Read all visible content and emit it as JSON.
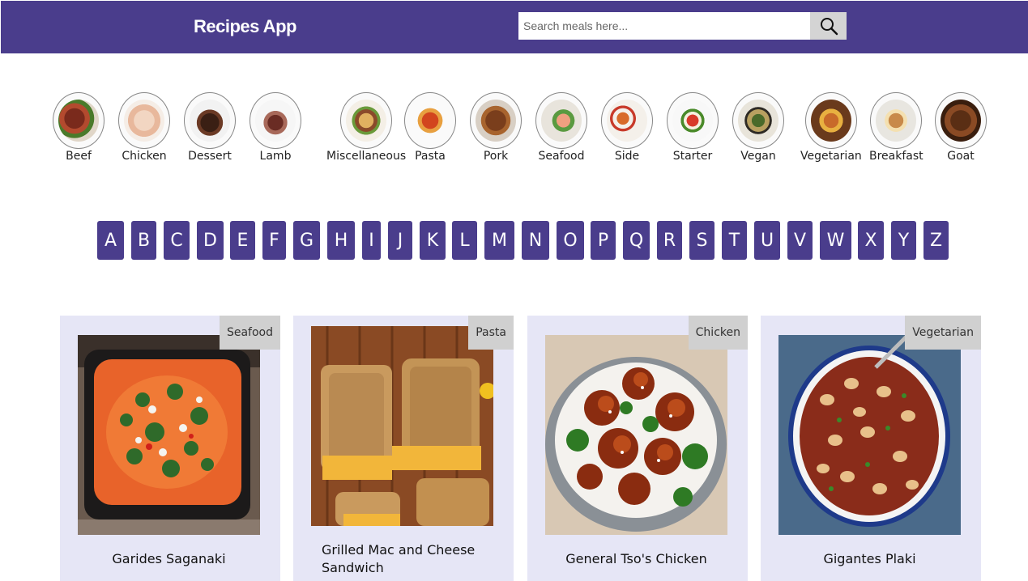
{
  "header": {
    "title": "Recipes App",
    "search_placeholder": "Search meals here...",
    "search_icon": "search-icon"
  },
  "categories": [
    {
      "label": "Beef"
    },
    {
      "label": "Chicken"
    },
    {
      "label": "Dessert"
    },
    {
      "label": "Lamb"
    },
    {
      "label": "Miscellaneous"
    },
    {
      "label": "Pasta"
    },
    {
      "label": "Pork"
    },
    {
      "label": "Seafood"
    },
    {
      "label": "Side"
    },
    {
      "label": "Starter"
    },
    {
      "label": "Vegan"
    },
    {
      "label": "Vegetarian"
    },
    {
      "label": "Breakfast"
    },
    {
      "label": "Goat"
    }
  ],
  "letters": [
    "A",
    "B",
    "C",
    "D",
    "E",
    "F",
    "G",
    "H",
    "I",
    "J",
    "K",
    "L",
    "M",
    "N",
    "O",
    "P",
    "Q",
    "R",
    "S",
    "T",
    "U",
    "V",
    "W",
    "X",
    "Y",
    "Z"
  ],
  "meals": [
    {
      "category": "Seafood",
      "title": "Garides Saganaki"
    },
    {
      "category": "Pasta",
      "title": "Grilled Mac and Cheese Sandwich"
    },
    {
      "category": "Chicken",
      "title": "General Tso's Chicken"
    },
    {
      "category": "Vegetarian",
      "title": "Gigantes Plaki"
    }
  ],
  "colors": {
    "brand": "#4a3d8c",
    "card_bg": "#e6e6f6",
    "badge_bg": "#d0d0d0"
  }
}
